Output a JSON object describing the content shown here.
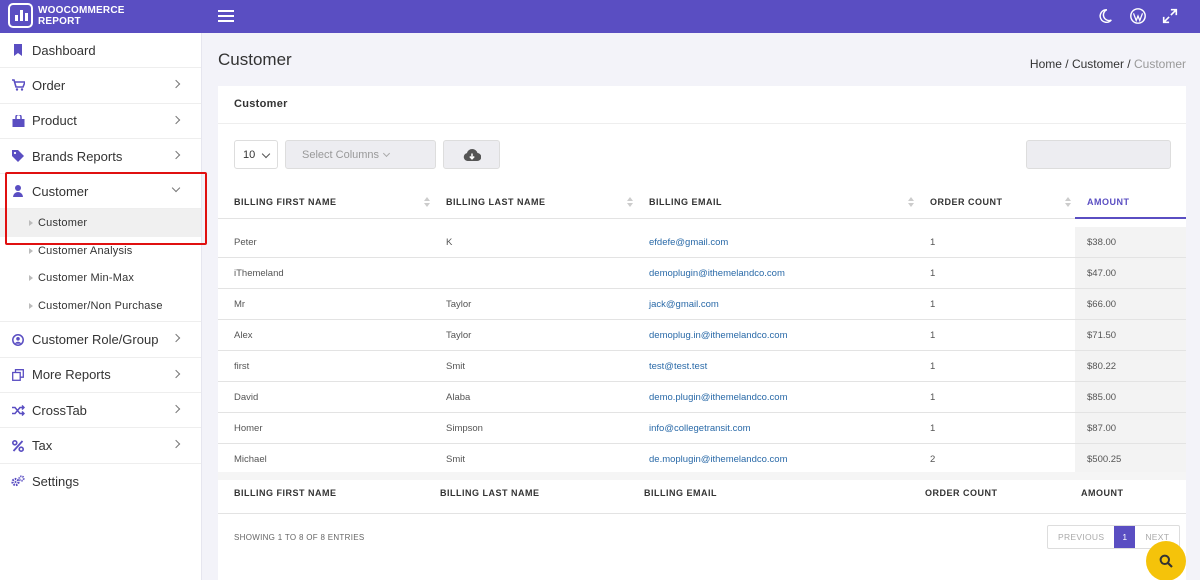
{
  "brand": {
    "line1": "WOOCOMMERCE",
    "line2": "REPORT"
  },
  "sidebar": {
    "items": [
      {
        "label": "Dashboard",
        "icon": "bookmark-icon",
        "has_chevron": false
      },
      {
        "label": "Order",
        "icon": "cart-icon",
        "has_chevron": true
      },
      {
        "label": "Product",
        "icon": "shopping-bag-icon",
        "has_chevron": true
      },
      {
        "label": "Brands Reports",
        "icon": "tag-icon",
        "has_chevron": true
      },
      {
        "label": "Customer",
        "icon": "user-icon",
        "has_chevron": true,
        "expanded": true
      },
      {
        "label": "Customer Role/Group",
        "icon": "user-circle-icon",
        "has_chevron": true
      },
      {
        "label": "More Reports",
        "icon": "copy-icon",
        "has_chevron": true
      },
      {
        "label": "CrossTab",
        "icon": "shuffle-icon",
        "has_chevron": true
      },
      {
        "label": "Tax",
        "icon": "percent-icon",
        "has_chevron": true
      },
      {
        "label": "Settings",
        "icon": "gears-icon",
        "has_chevron": false
      }
    ],
    "customer_sub": [
      {
        "label": "Customer",
        "active": true
      },
      {
        "label": "Customer Analysis"
      },
      {
        "label": "Customer Min-Max"
      },
      {
        "label": "Customer/Non Purchase"
      }
    ]
  },
  "page": {
    "title": "Customer",
    "breadcrumb": {
      "home": "Home",
      "sep1": " / ",
      "section": "Customer",
      "sep2": " / ",
      "current": "Customer"
    }
  },
  "card": {
    "title": "Customer",
    "page_length": "10",
    "select_columns_placeholder": "Select Columns",
    "columns": [
      "BILLING FIRST NAME",
      "BILLING LAST NAME",
      "BILLING EMAIL",
      "ORDER COUNT",
      "AMOUNT"
    ],
    "rows": [
      [
        "Peter",
        "K",
        "efdefe@gmail.com",
        "1",
        "$38.00"
      ],
      [
        "iThemeland",
        "",
        "demoplugin@ithemelandco.com",
        "1",
        "$47.00"
      ],
      [
        "Mr",
        "Taylor",
        "jack@gmail.com",
        "1",
        "$66.00"
      ],
      [
        "Alex",
        "Taylor",
        "demoplug.in@ithemelandco.com",
        "1",
        "$71.50"
      ],
      [
        "first",
        "Smit",
        "test@test.test",
        "1",
        "$80.22"
      ],
      [
        "David",
        "Alaba",
        "demo.plugin@ithemelandco.com",
        "1",
        "$85.00"
      ],
      [
        "Homer",
        "Simpson",
        "info@collegetransit.com",
        "1",
        "$87.00"
      ],
      [
        "Michael",
        "Smit",
        "de.moplugin@ithemelandco.com",
        "2",
        "$500.25"
      ]
    ],
    "footer_columns": [
      "BILLING FIRST NAME",
      "BILLING LAST NAME",
      "BILLING EMAIL",
      "ORDER COUNT",
      "AMOUNT"
    ],
    "info": "SHOWING 1 TO 8 OF 8 ENTRIES",
    "pager": {
      "prev": "PREVIOUS",
      "page": "1",
      "next": "NEXT"
    }
  },
  "colors": {
    "accent": "#5a4ec2",
    "highlight": "#e01010",
    "fab": "#f5c30a",
    "email": "#2a6aa8"
  }
}
